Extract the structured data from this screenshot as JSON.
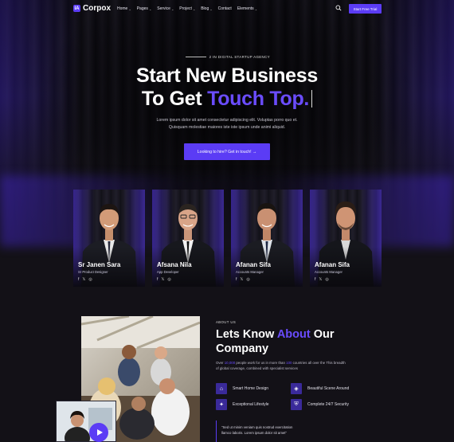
{
  "nav": {
    "logo_mark": "IA",
    "logo_text": "Corpox",
    "menu": [
      {
        "label": "Home",
        "has_dropdown": true
      },
      {
        "label": "Pages",
        "has_dropdown": true
      },
      {
        "label": "Service",
        "has_dropdown": true
      },
      {
        "label": "Project",
        "has_dropdown": true
      },
      {
        "label": "Blog",
        "has_dropdown": true
      },
      {
        "label": "Contact",
        "has_dropdown": false
      },
      {
        "label": "Elements",
        "has_dropdown": true
      }
    ],
    "search_icon": "search-icon",
    "cta_label": "Start Free Trial"
  },
  "hero": {
    "eyebrow": "2 IN DIGITAL STARTUP AGENCY",
    "title_line1": "Start New Business",
    "title_line2_prefix": "To Get ",
    "title_line2_accent": "Touch Top.",
    "subtitle_line1": "Lorem ipsum dolor sit amet consectetur adipiscing elit. Voluptas porro quo et.",
    "subtitle_line2": "Quisquam molestiae maiores iste iste ipsum unde animi aliquid.",
    "cta_label": "Looking to hire? Get in touch! →"
  },
  "team": [
    {
      "name": "Sr Janen Sara",
      "role": "Sr Product Designer"
    },
    {
      "name": "Afsana Nila",
      "role": "App Developer"
    },
    {
      "name": "Afanan Sifa",
      "role": "Accounts Manager"
    },
    {
      "name": "Afanan Sifa",
      "role": "Accounts Manager"
    }
  ],
  "socials": [
    "f",
    "𝕏",
    "◎"
  ],
  "about": {
    "tag": "ABOUT US",
    "title_l1_prefix": "Lets Know ",
    "title_l1_accent": "About",
    "title_l1_suffix": " Our",
    "title_l2": "Company",
    "p1_prefix": "Over ",
    "p1_hl1": "10,000",
    "p1_mid": " people work for us in more than ",
    "p1_hl2": "100",
    "p1_suffix": " countries all over the This breadth",
    "p2": "of global coverage, combined with specialist services",
    "features": [
      {
        "label": "Smart Home Design",
        "icon": "home-icon"
      },
      {
        "label": "Beautiful Scene Around",
        "icon": "scene-icon"
      },
      {
        "label": "Exceptional Lifestyle",
        "icon": "lifestyle-icon"
      },
      {
        "label": "Complete 24/7 Security",
        "icon": "security-icon"
      }
    ],
    "quote_l1": "\"Sed ut minim veniam quis nostrud exercitation",
    "quote_l2": "llamco laboris. Lorem ipsum dolor sit amet\""
  },
  "colors": {
    "accent": "#5b3cf5",
    "accent_text": "#6a4cff",
    "background": "#131117"
  }
}
